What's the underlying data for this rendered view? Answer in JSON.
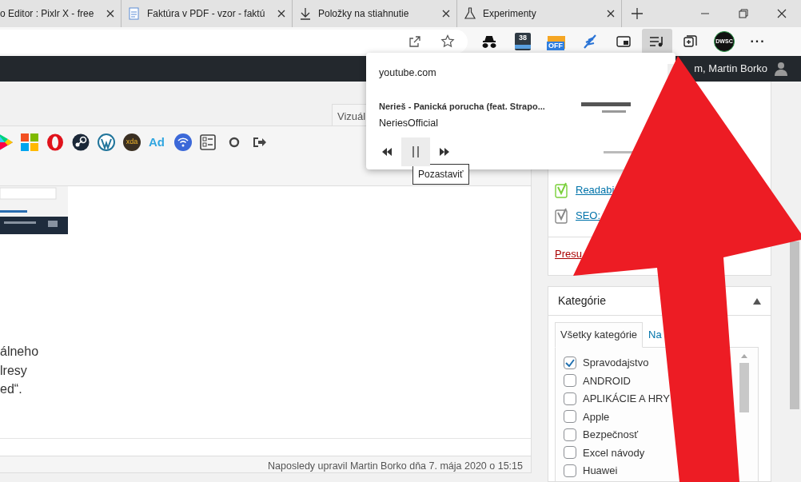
{
  "browser_tabs": [
    {
      "title": "o Editor : Pixlr X - free",
      "kind": "plain",
      "selected": false
    },
    {
      "title": "Faktúra v PDF - vzor - faktú",
      "kind": "doc",
      "selected": false
    },
    {
      "title": "Položky na stiahnutie",
      "kind": "download",
      "selected": false
    },
    {
      "title": "Experimenty",
      "kind": "flask",
      "selected": false
    }
  ],
  "extensions": [
    {
      "kind": "spy"
    },
    {
      "kind": "calendar",
      "text": "38"
    },
    {
      "kind": "offer",
      "text": "OFF"
    },
    {
      "kind": "feather"
    },
    {
      "kind": "pip"
    },
    {
      "kind": "media",
      "selected": true
    },
    {
      "kind": "collections"
    },
    {
      "kind": "circle",
      "text": "DWSC"
    },
    {
      "kind": "more",
      "text": "···"
    }
  ],
  "admin_bar": {
    "greeting": "m, Martin Borko"
  },
  "editor": {
    "tab": "Vizuál",
    "toolbar": [
      {
        "kind": "play"
      },
      {
        "kind": "windows"
      },
      {
        "kind": "opera"
      },
      {
        "kind": "steam"
      },
      {
        "kind": "wordpress"
      },
      {
        "kind": "xda",
        "text": "xda"
      },
      {
        "kind": "ad",
        "text": "Ad"
      },
      {
        "kind": "wifi"
      },
      {
        "kind": "list"
      },
      {
        "kind": "ring"
      },
      {
        "kind": "exit"
      }
    ],
    "lines": [
      "álneho",
      "lresy",
      "ed“."
    ],
    "status": "Naposledy upravil Martin Borko dňa 7. mája 2020 o 15:15"
  },
  "publish_box": {
    "checks": [
      {
        "label": "Readabi",
        "ok": true
      },
      {
        "label": "SEO:",
        "ok": false
      }
    ],
    "trash_link": "Presu"
  },
  "categories": {
    "title": "Kategórie",
    "tabs": [
      {
        "label": "Všetky kategórie",
        "selected": true
      },
      {
        "label": "Na",
        "selected": false
      }
    ],
    "items": [
      {
        "label": "Spravodajstvo",
        "checked": true
      },
      {
        "label": "ANDROID",
        "checked": false
      },
      {
        "label": "APLIKÁCIE A HRY",
        "checked": false
      },
      {
        "label": "Apple",
        "checked": false
      },
      {
        "label": "Bezpečnosť",
        "checked": false
      },
      {
        "label": "Excel návody",
        "checked": false
      },
      {
        "label": "Huawei",
        "checked": false
      }
    ]
  },
  "media_popup": {
    "site": "youtube.com",
    "track": "Nerieš - Panická porucha (feat. Strapo...",
    "artist": "NeriesOfficial",
    "playing": true,
    "tooltip": "Pozastaviť"
  }
}
